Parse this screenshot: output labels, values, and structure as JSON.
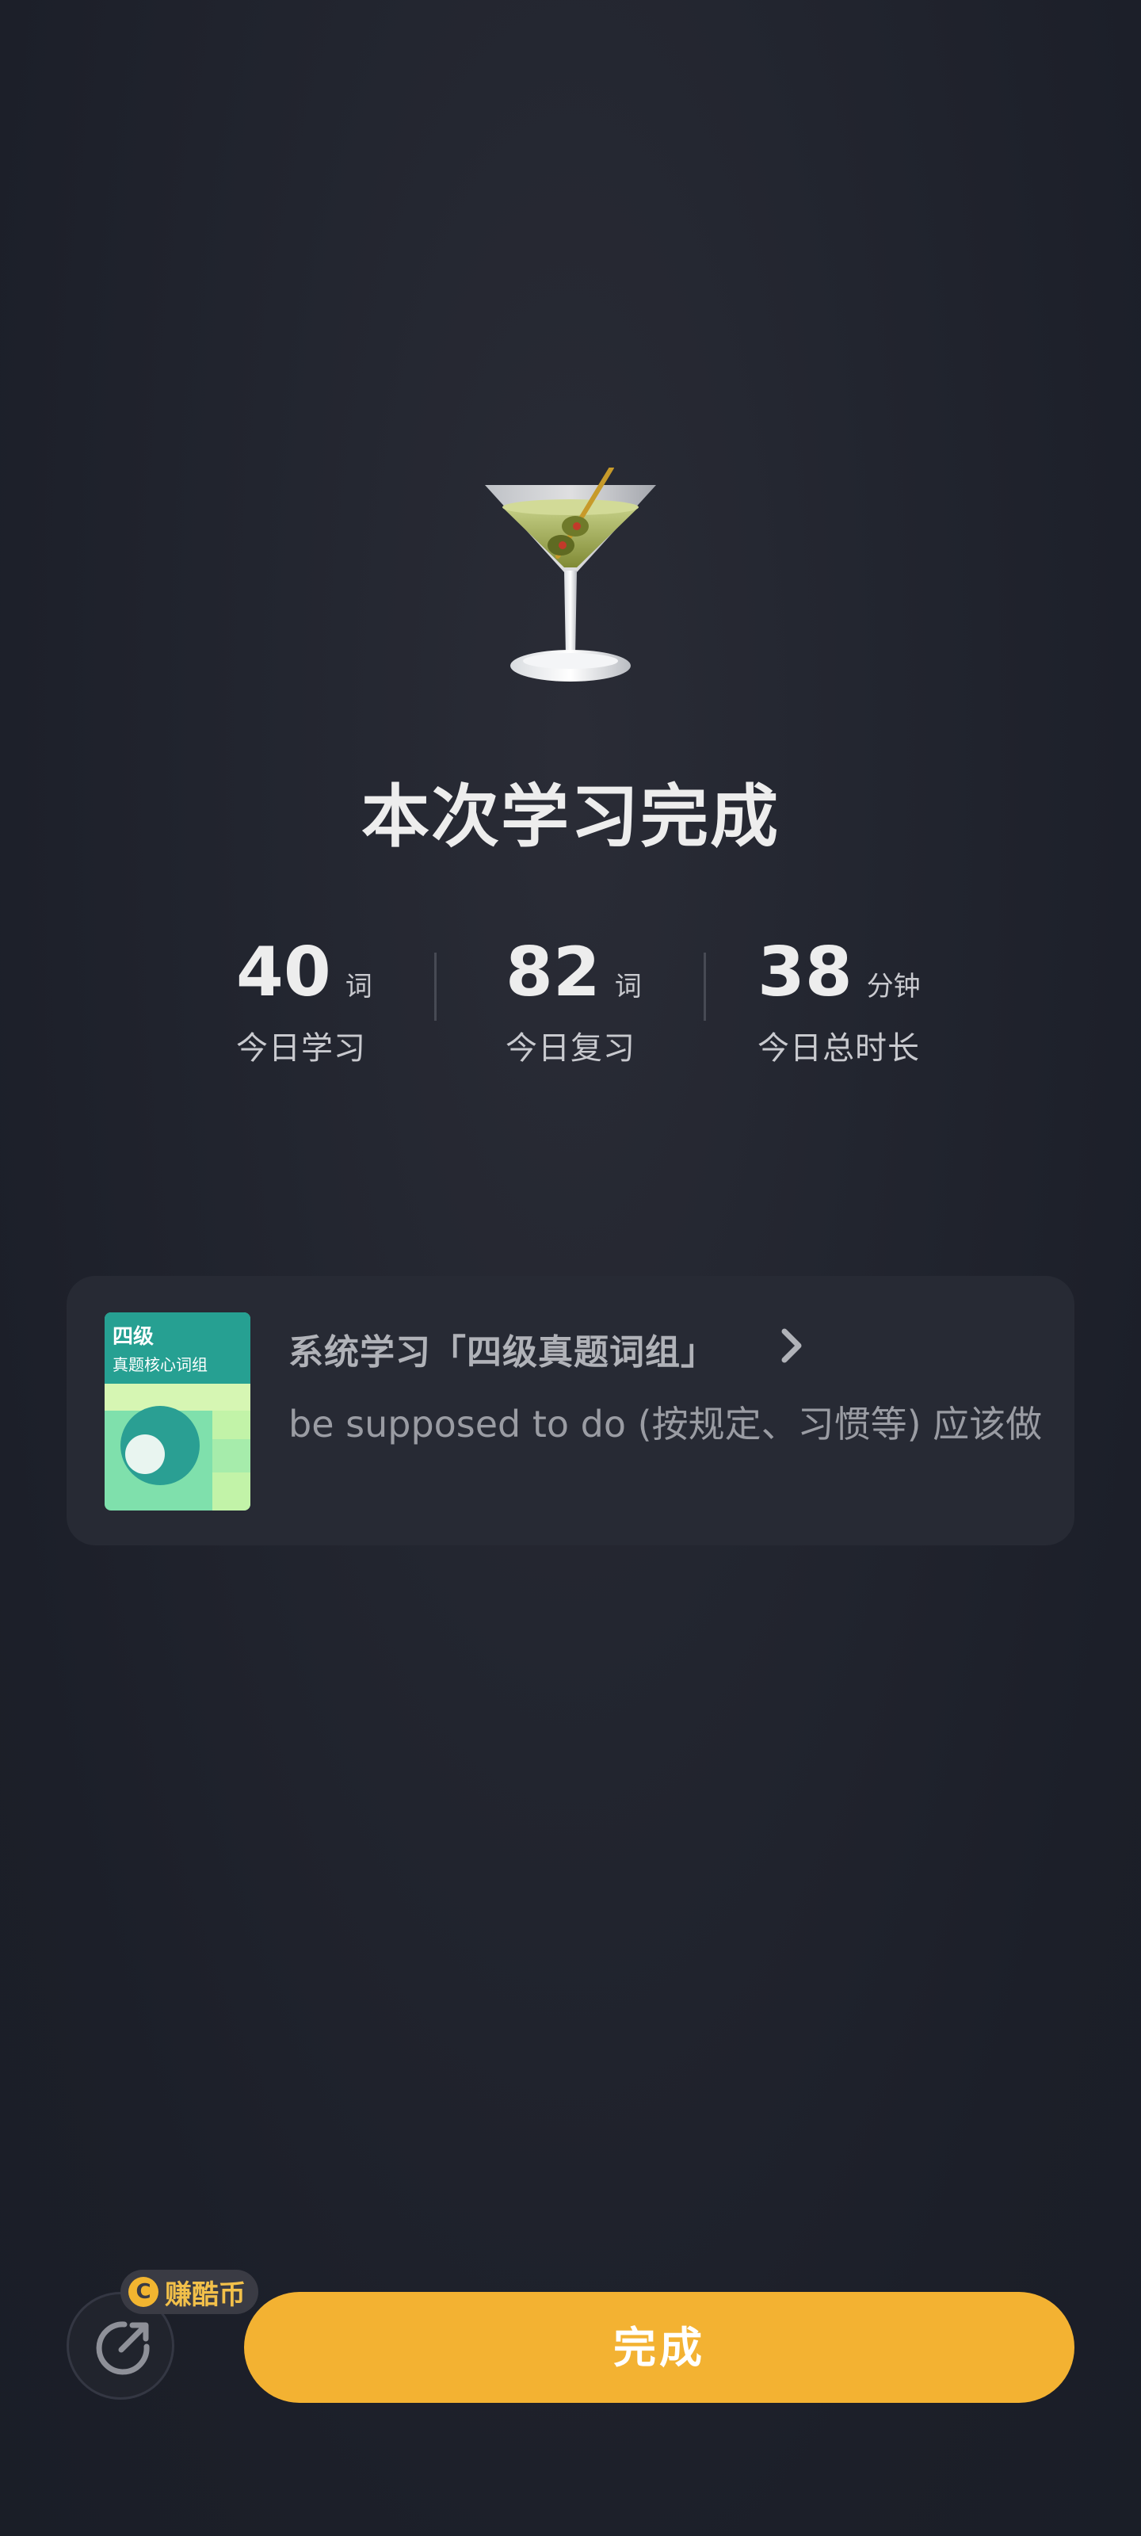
{
  "completion": {
    "icon": "cocktail-glass-icon",
    "title": "本次学习完成"
  },
  "stats": [
    {
      "value": "40",
      "unit": "词",
      "label": "今日学习"
    },
    {
      "value": "82",
      "unit": "词",
      "label": "今日复习"
    },
    {
      "value": "38",
      "unit": "分钟",
      "label": "今日总时长"
    }
  ],
  "book_card": {
    "cover_title": "四级",
    "cover_subtitle": "真题核心词组",
    "title": "系统学习「四级真题词组」",
    "chevron_icon": "chevron-right-icon",
    "description": "be supposed to do (按规定、习惯等) 应该做"
  },
  "bottom_bar": {
    "share_icon": "share-arrow-icon",
    "coin_icon_glyph": "C",
    "coin_label": "赚酷币",
    "done_label": "完成"
  },
  "colors": {
    "background": "#1e212b",
    "accent": "#f3b232",
    "card": "#272a34"
  }
}
